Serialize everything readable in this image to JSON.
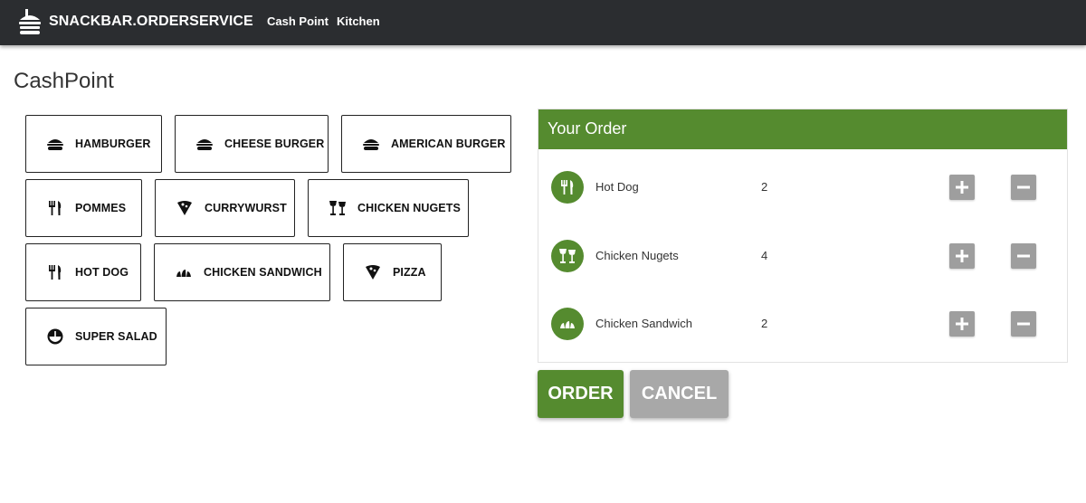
{
  "app": {
    "brand": "SNACKBAR.ORDERSERVICE",
    "nav": [
      "Cash Point",
      "Kitchen"
    ]
  },
  "page": {
    "title": "CashPoint"
  },
  "products": [
    {
      "label": "HAMBURGER",
      "icon": "burger-icon"
    },
    {
      "label": "CHEESE BURGER",
      "icon": "burger-icon"
    },
    {
      "label": "AMERICAN BURGER",
      "icon": "burger-icon"
    },
    {
      "label": "POMMES",
      "icon": "fork-knife-icon"
    },
    {
      "label": "CURRYWURST",
      "icon": "pizza-slice-icon"
    },
    {
      "label": "CHICKEN NUGETS",
      "icon": "drinks-icon"
    },
    {
      "label": "HOT DOG",
      "icon": "fork-knife-icon"
    },
    {
      "label": "CHICKEN SANDWICH",
      "icon": "croissant-icon"
    },
    {
      "label": "PIZZA",
      "icon": "pizza-slice-icon"
    },
    {
      "label": "SUPER SALAD",
      "icon": "salad-bowl-icon"
    }
  ],
  "order": {
    "title": "Your Order",
    "items": [
      {
        "name": "Hot Dog",
        "qty": "2",
        "icon": "fork-knife-icon"
      },
      {
        "name": "Chicken Nugets",
        "qty": "4",
        "icon": "drinks-icon"
      },
      {
        "name": "Chicken Sandwich",
        "qty": "2",
        "icon": "croissant-icon"
      }
    ],
    "order_label": "ORDER",
    "cancel_label": "CANCEL"
  },
  "colors": {
    "topbar": "#2b2d30",
    "accent_green": "#558b2f",
    "button_grey": "#9e9e9e",
    "cancel_grey": "#a8a8a8"
  }
}
